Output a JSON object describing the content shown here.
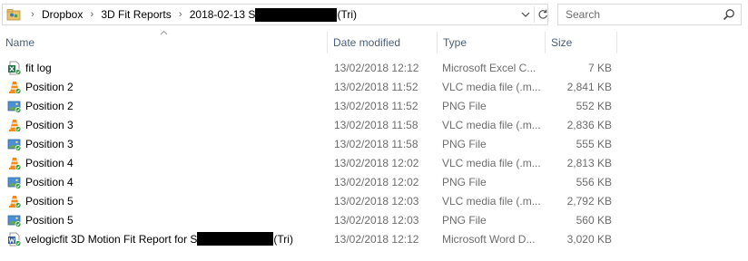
{
  "address": {
    "crumbs": [
      "Dropbox",
      "3D Fit Reports",
      "2018-02-13 S"
    ],
    "crumb_suffix": "(Tri)"
  },
  "search": {
    "placeholder": "Search"
  },
  "columns": {
    "name": "Name",
    "date": "Date modified",
    "type": "Type",
    "size": "Size"
  },
  "files": [
    {
      "name": "fit log",
      "date": "13/02/2018 12:12",
      "type": "Microsoft Excel C...",
      "size": "7 KB",
      "icon": "excel-file-icon"
    },
    {
      "name": "Position 2",
      "date": "13/02/2018 11:52",
      "type": "VLC media file (.m...",
      "size": "2,841 KB",
      "icon": "vlc-file-icon"
    },
    {
      "name": "Position 2",
      "date": "13/02/2018 11:52",
      "type": "PNG File",
      "size": "552 KB",
      "icon": "png-file-icon"
    },
    {
      "name": "Position 3",
      "date": "13/02/2018 11:58",
      "type": "VLC media file (.m...",
      "size": "2,836 KB",
      "icon": "vlc-file-icon"
    },
    {
      "name": "Position 3",
      "date": "13/02/2018 11:58",
      "type": "PNG File",
      "size": "555 KB",
      "icon": "png-file-icon"
    },
    {
      "name": "Position 4",
      "date": "13/02/2018 12:02",
      "type": "VLC media file (.m...",
      "size": "2,813 KB",
      "icon": "vlc-file-icon"
    },
    {
      "name": "Position 4",
      "date": "13/02/2018 12:02",
      "type": "PNG File",
      "size": "556 KB",
      "icon": "png-file-icon"
    },
    {
      "name": "Position 5",
      "date": "13/02/2018 12:03",
      "type": "VLC media file (.m...",
      "size": "2,792 KB",
      "icon": "vlc-file-icon"
    },
    {
      "name": "Position 5",
      "date": "13/02/2018 12:03",
      "type": "PNG File",
      "size": "560 KB",
      "icon": "png-file-icon"
    },
    {
      "name": "velogicfit 3D Motion Fit Report for S",
      "name_suffix": "(Tri)",
      "date": "13/02/2018 12:12",
      "type": "Microsoft Word D...",
      "size": "3,020 KB",
      "icon": "word-file-icon"
    }
  ],
  "colors": {
    "header_text": "#4c607a",
    "secondary_text": "#6d6d6d",
    "border": "#d9d9d9"
  }
}
